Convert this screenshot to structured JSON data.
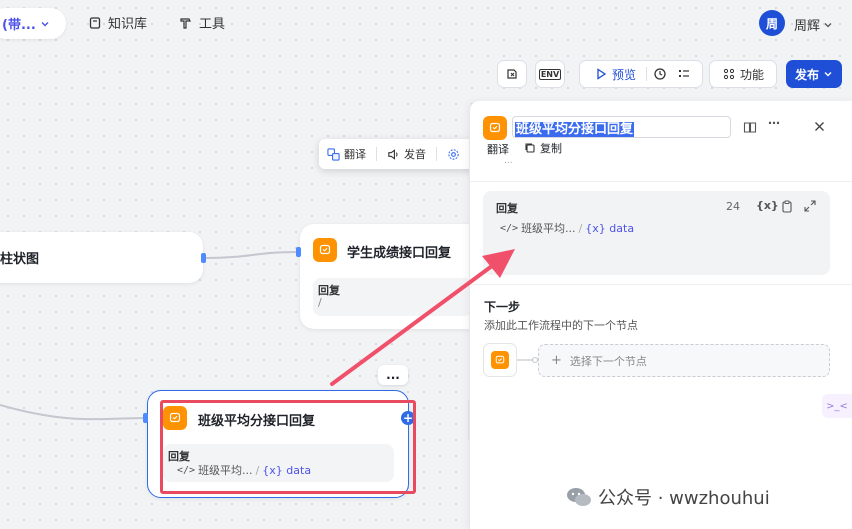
{
  "nav": {
    "app_title": "(带...",
    "knowledge": "知识库",
    "tools": "工具",
    "avatar_char": "周",
    "username": "周辉"
  },
  "toolbar": {
    "env": "ENV",
    "preview": "预览",
    "features": "功能",
    "publish": "发布"
  },
  "float_bar": {
    "translate": "翻译",
    "pronounce": "发音"
  },
  "canvas": {
    "chart_node_title": "柱状图",
    "student_node": {
      "title": "学生成绩接口回复",
      "reply_label": "回复",
      "reply_value": "/"
    },
    "class_node": {
      "more": "...",
      "title": "班级平均分接口回复",
      "reply_label": "回复",
      "var_name": "班级平均...",
      "var_sep": "/",
      "var_type": "{x} data"
    }
  },
  "panel": {
    "title": "班级平均分接口回复",
    "behind_translate": "翻译",
    "behind_copy": "复制",
    "behind_desc": "...",
    "output": {
      "label": "回复",
      "count": "24",
      "var_icon": "{x}",
      "var_name": "班级平均...",
      "var_sep": "/",
      "var_type": "{x} data"
    },
    "next": {
      "title": "下一步",
      "desc": "添加此工作流程中的下一个节点",
      "select_placeholder": "选择下一个节点"
    }
  },
  "watermark": {
    "text": "公众号 · wwzhouhui"
  },
  "colors": {
    "primary": "#1f4fd6",
    "node_icon": "#ff9200",
    "annotation_red": "#e84a5f"
  }
}
